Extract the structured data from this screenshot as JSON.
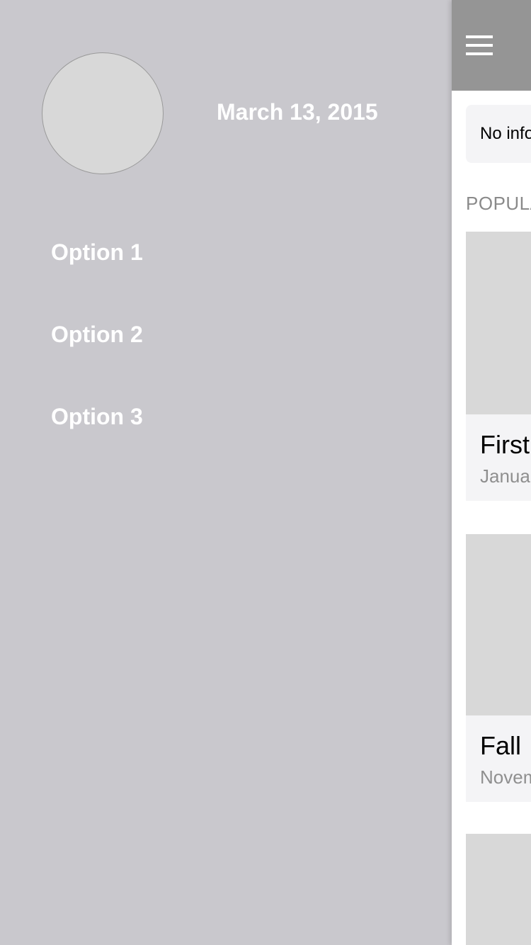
{
  "drawer": {
    "date": "March 13, 2015",
    "items": [
      {
        "label": "Option 1"
      },
      {
        "label": "Option 2"
      },
      {
        "label": "Option 3"
      }
    ]
  },
  "main": {
    "info_text": "No info",
    "section_header": "POPULAR",
    "cards": [
      {
        "title": "First",
        "date": "January"
      },
      {
        "title": "Fall",
        "date": "November"
      },
      {
        "title": "",
        "date": ""
      }
    ]
  },
  "colors": {
    "drawer_background": "#c9c8cd",
    "navbar_background": "#959595",
    "placeholder_image": "#d8d8d8",
    "card_background": "#f4f4f6"
  }
}
